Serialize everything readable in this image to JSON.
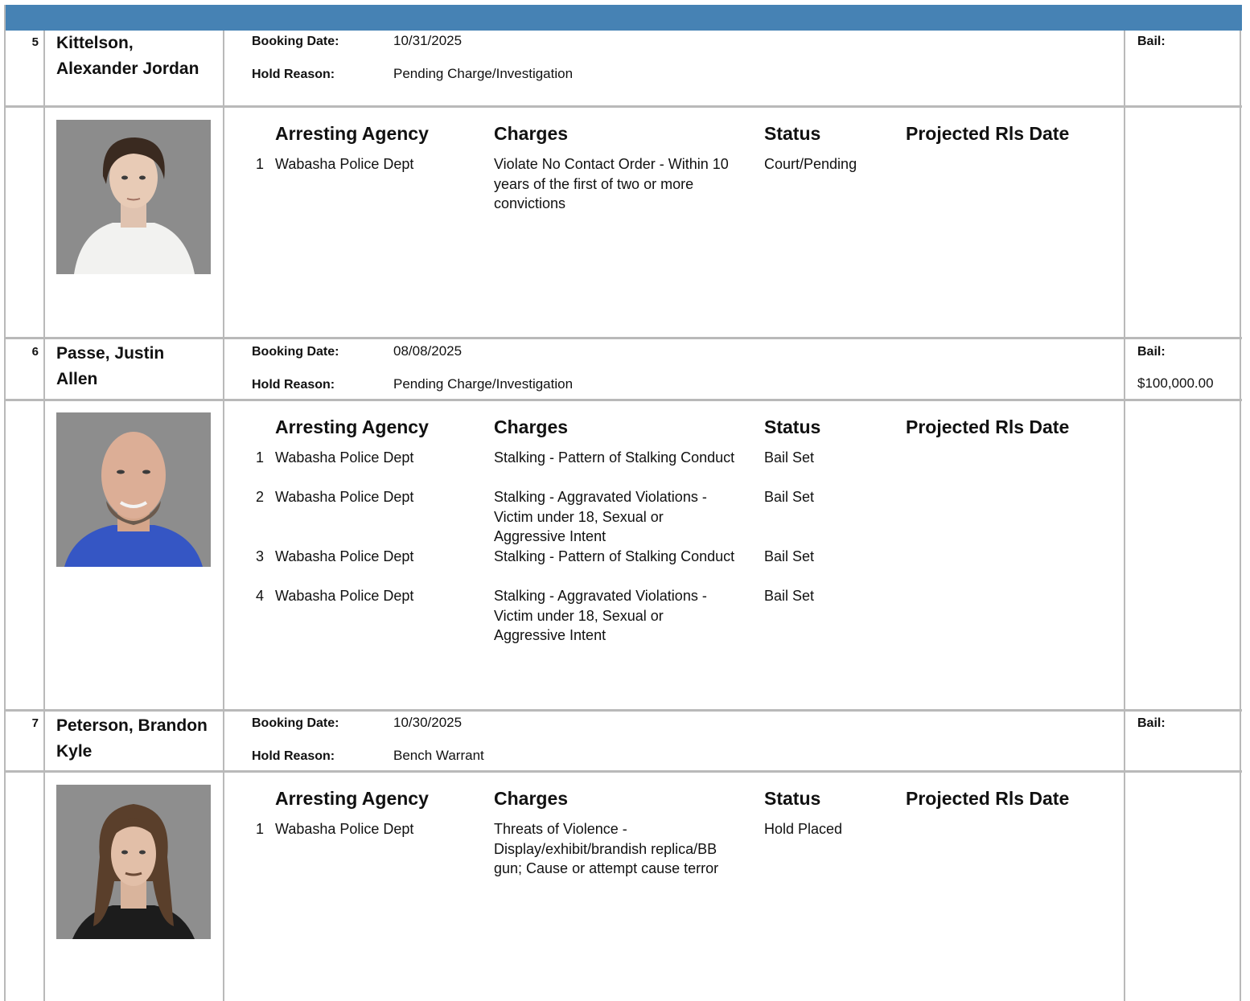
{
  "labels": {
    "booking_date": "Booking Date:",
    "hold_reason": "Hold Reason:",
    "bail": "Bail:",
    "col_agency": "Arresting Agency",
    "col_charges": "Charges",
    "col_status": "Status",
    "col_release": "Projected Rls Date"
  },
  "inmates": [
    {
      "number": "5",
      "name": "Kittelson, Alexander Jordan",
      "booking_date": "10/31/2025",
      "hold_reason": "Pending Charge/Investigation",
      "bail": "",
      "photo": "mugshot-photo",
      "charges": [
        {
          "n": "1",
          "agency": "Wabasha Police Dept",
          "charge": "Violate No Contact Order - Within 10 years of the first of two or more convictions",
          "status": "Court/Pending",
          "release": ""
        }
      ]
    },
    {
      "number": "6",
      "name": "Passe, Justin Allen",
      "booking_date": "08/08/2025",
      "hold_reason": "Pending Charge/Investigation",
      "bail": "$100,000.00",
      "photo": "mugshot-photo",
      "charges": [
        {
          "n": "1",
          "agency": "Wabasha Police Dept",
          "charge": "Stalking - Pattern of Stalking Conduct",
          "status": "Bail Set",
          "release": ""
        },
        {
          "n": "2",
          "agency": "Wabasha Police Dept",
          "charge": "Stalking - Aggravated Violations - Victim under 18, Sexual or Aggressive Intent",
          "status": "Bail Set",
          "release": ""
        },
        {
          "n": "3",
          "agency": "Wabasha Police Dept",
          "charge": "Stalking - Pattern of Stalking Conduct",
          "status": "Bail Set",
          "release": ""
        },
        {
          "n": "4",
          "agency": "Wabasha Police Dept",
          "charge": "Stalking - Aggravated Violations - Victim under 18, Sexual or Aggressive Intent",
          "status": "Bail Set",
          "release": ""
        }
      ]
    },
    {
      "number": "7",
      "name": "Peterson, Brandon Kyle",
      "booking_date": "10/30/2025",
      "hold_reason": "Bench Warrant",
      "bail": "",
      "photo": "mugshot-photo",
      "charges": [
        {
          "n": "1",
          "agency": "Wabasha Police Dept",
          "charge": "Threats of Violence - Display/exhibit/brandish replica/BB gun; Cause or attempt cause terror",
          "status": "Hold Placed",
          "release": ""
        }
      ]
    }
  ]
}
